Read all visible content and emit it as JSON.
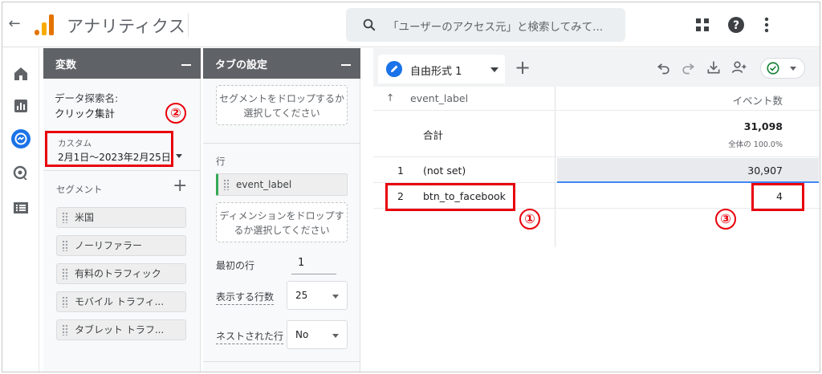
{
  "topbar": {
    "back_glyph": "←",
    "app_title": "アナリティクス",
    "search_placeholder": "「ユーザーのアクセス元」と検索してみて...",
    "icons": [
      "apps-grid-icon",
      "help-icon",
      "more-vert-icon"
    ]
  },
  "leftnav": {
    "icons": [
      "home-icon",
      "reports-icon",
      "explore-icon",
      "advertising-icon",
      "configure-list-icon"
    ],
    "active": "explore-icon",
    "accent": "#1a73e8"
  },
  "variables_panel": {
    "title": "変数",
    "exploration_name_label": "データ探索名:",
    "exploration_name": "クリック集計",
    "date_label": "カスタム",
    "date_range": "2月1日〜2023年2月25日",
    "segment_label": "セグメント",
    "segments": [
      "米国",
      "ノーリファラー",
      "有料のトラフィック",
      "モバイル トラフィ...",
      "タブレット トラフ..."
    ]
  },
  "tab_settings_panel": {
    "title": "タブの設定",
    "segment_drop": "セグメントをドロップするか選択してください",
    "rows_label": "行",
    "row_dimension": "event_label",
    "dimension_drop": "ディメンションをドロップするか選択してください",
    "first_row_label": "最初の行",
    "first_row_value": "1",
    "rows_shown_label": "表示する行数",
    "rows_shown_value": "25",
    "nested_rows_label": "ネストされた行",
    "nested_rows_value": "No"
  },
  "main": {
    "tab_name": "自由形式 1",
    "add_tab": "+",
    "toolbar_icons": [
      "undo-icon",
      "redo-icon",
      "download-icon",
      "share-icon",
      "check-circle-icon"
    ],
    "status_color": "#188038",
    "table": {
      "sort_glyph": "↑",
      "dimension_header": "event_label",
      "metric_header": "イベント数",
      "total_label": "合計",
      "total_value": "31,098",
      "total_pct": "全体の 100.0%",
      "rows": [
        {
          "index": "1",
          "label": "(not set)",
          "value": "30,907",
          "fraction": 1.0
        },
        {
          "index": "2",
          "label": "btn_to_facebook",
          "value": "4",
          "fraction": 0.0001
        }
      ]
    }
  },
  "annotations": {
    "color": "#e8000b",
    "n1": "①",
    "n2": "②",
    "n3": "③"
  }
}
